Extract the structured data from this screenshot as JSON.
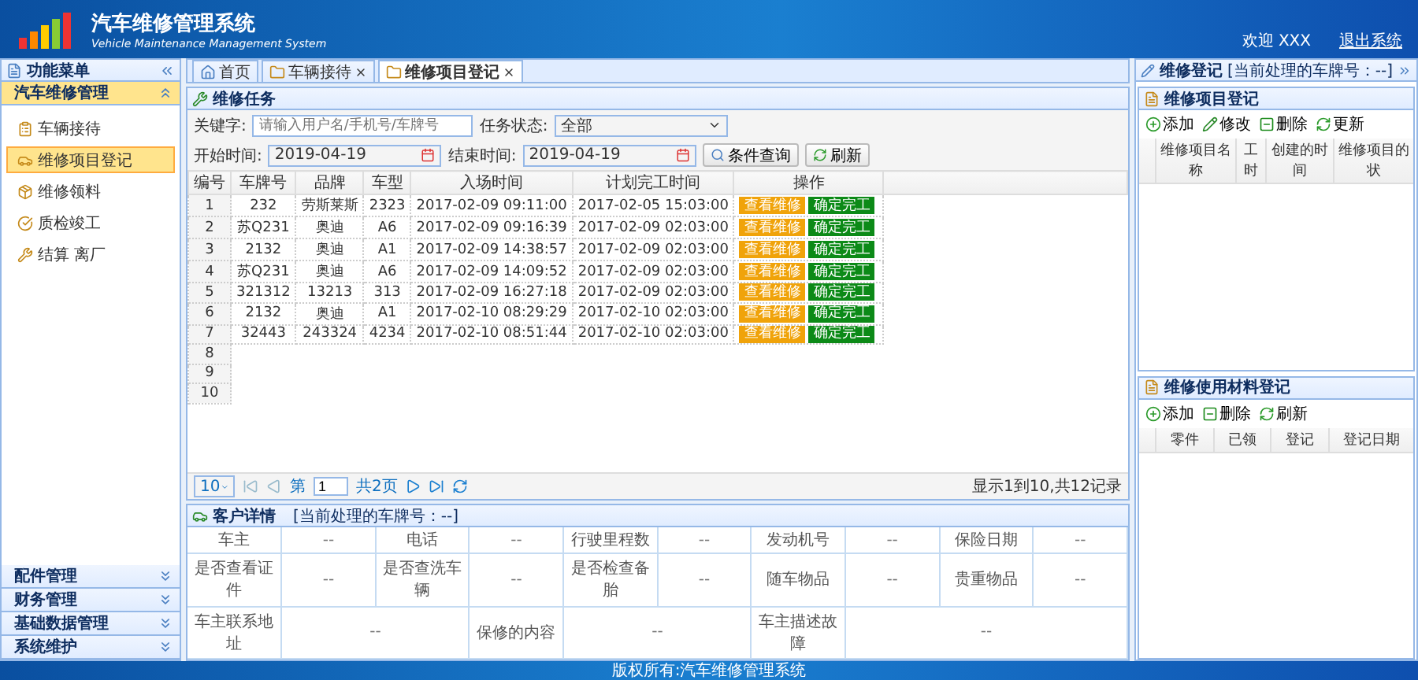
{
  "header": {
    "title": "汽车维修管理系统",
    "subtitle": "Vehicle Maintenance Management System",
    "welcome": "欢迎 XXX",
    "logout": "退出系统"
  },
  "sidebar": {
    "title": "功能菜单",
    "groups": [
      {
        "label": "汽车维修管理",
        "expanded": true,
        "items": [
          {
            "label": "车辆接待",
            "selected": false
          },
          {
            "label": "维修项目登记",
            "selected": true
          },
          {
            "label": "维修领料",
            "selected": false
          },
          {
            "label": "质检竣工",
            "selected": false
          },
          {
            "label": "结算 离厂",
            "selected": false
          }
        ]
      },
      {
        "label": "配件管理",
        "expanded": false
      },
      {
        "label": "财务管理",
        "expanded": false
      },
      {
        "label": "基础数据管理",
        "expanded": false
      },
      {
        "label": "系统维护",
        "expanded": false
      }
    ]
  },
  "tabs": [
    {
      "label": "首页",
      "closable": false,
      "selected": false
    },
    {
      "label": "车辆接待",
      "closable": true,
      "selected": false
    },
    {
      "label": "维修项目登记",
      "closable": true,
      "selected": true
    }
  ],
  "task_panel": {
    "title": "维修任务",
    "filters": {
      "keyword_label": "关键字:",
      "keyword_placeholder": "请输入用户名/手机号/车牌号",
      "status_label": "任务状态:",
      "status_value": "全部",
      "start_label": "开始时间:",
      "start_value": "2019-04-19",
      "end_label": "结束时间:",
      "end_value": "2019-04-19",
      "search_button": "条件查询",
      "refresh_button": "刷新"
    },
    "columns": [
      "编号",
      "车牌号",
      "品牌",
      "车型",
      "入场时间",
      "计划完工时间",
      "操作"
    ],
    "rows": [
      {
        "no": "1",
        "cells": [
          "232",
          "劳斯莱斯",
          "2323",
          "2017-02-09 09:11:00",
          "2017-02-05 15:03:00"
        ],
        "actions": [
          {
            "label": "查看维修",
            "kind": "view"
          },
          {
            "label": "确定完工",
            "kind": "finish"
          }
        ]
      },
      {
        "no": "2",
        "cells": [
          "苏Q231",
          "奥迪",
          "A6",
          "2017-02-09 09:16:39",
          "2017-02-09 02:03:00"
        ],
        "actions": [
          {
            "label": "查看维修",
            "kind": "view"
          },
          {
            "label": "确定完工",
            "kind": "finish"
          }
        ]
      },
      {
        "no": "3",
        "cells": [
          "2132",
          "奥迪",
          "A1",
          "2017-02-09 14:38:57",
          "2017-02-09 02:03:00"
        ],
        "actions": [
          {
            "label": "查看维修",
            "kind": "view"
          },
          {
            "label": "确定完工",
            "kind": "finish"
          }
        ]
      },
      {
        "no": "4",
        "cells": [
          "苏Q231",
          "奥迪",
          "A6",
          "2017-02-09 14:09:52",
          "2017-02-09 02:03:00"
        ],
        "actions": [
          {
            "label": "查看维修",
            "kind": "view"
          },
          {
            "label": "确定完工",
            "kind": "finish"
          }
        ]
      },
      {
        "no": "5",
        "cells": [
          "321312",
          "13213",
          "313",
          "2017-02-09 16:27:18",
          "2017-02-09 02:03:00"
        ],
        "actions": [
          {
            "label": "查看维修",
            "kind": "view"
          },
          {
            "label": "确定完工",
            "kind": "finish"
          }
        ]
      },
      {
        "no": "6",
        "cells": [
          "2132",
          "奥迪",
          "A1",
          "2017-02-10 08:29:29",
          "2017-02-10 02:03:00"
        ],
        "actions": [
          {
            "label": "查看维修",
            "kind": "view"
          },
          {
            "label": "确定完工",
            "kind": "finish"
          }
        ]
      },
      {
        "no": "7",
        "cells": [
          "32443",
          "243324",
          "4234",
          "2017-02-10 08:51:44",
          "2017-02-10 02:03:00"
        ],
        "actions": [
          {
            "label": "查看维修",
            "kind": "view"
          },
          {
            "label": "确定完工",
            "kind": "finish"
          }
        ]
      },
      {
        "no": "8"
      },
      {
        "no": "9"
      },
      {
        "no": "10"
      }
    ],
    "pager": {
      "page_size": "10",
      "page_label": "第",
      "page_value": "1",
      "page_total": "共2页",
      "summary": "显示1到10,共12记录"
    }
  },
  "detail": {
    "title": "客户详情",
    "note": "[当前处理的车牌号：--]",
    "rows": [
      [
        {
          "text": "车主",
          "kind": "label"
        },
        {
          "text": "--",
          "kind": "value"
        },
        {
          "text": "电话",
          "kind": "label"
        },
        {
          "text": "--",
          "kind": "value"
        },
        {
          "text": "行驶里程数",
          "kind": "label"
        },
        {
          "text": "--",
          "kind": "value"
        },
        {
          "text": "发动机号",
          "kind": "label"
        },
        {
          "text": "--",
          "kind": "value"
        },
        {
          "text": "保险日期",
          "kind": "label"
        },
        {
          "text": "--",
          "kind": "value"
        }
      ],
      [
        {
          "text": "是否查看证件",
          "kind": "label"
        },
        {
          "text": "--",
          "kind": "value"
        },
        {
          "text": "是否查洗车辆",
          "kind": "label"
        },
        {
          "text": "--",
          "kind": "value"
        },
        {
          "text": "是否检查备胎",
          "kind": "label"
        },
        {
          "text": "--",
          "kind": "value"
        },
        {
          "text": "随车物品",
          "kind": "label"
        },
        {
          "text": "--",
          "kind": "value"
        },
        {
          "text": "贵重物品",
          "kind": "label"
        },
        {
          "text": "--",
          "kind": "value"
        }
      ],
      [
        {
          "text": "车主联系地址",
          "kind": "label"
        },
        {
          "text": "--",
          "kind": "value",
          "colspan": 2
        },
        {
          "text": "保修的内容",
          "kind": "label"
        },
        {
          "text": "--",
          "kind": "value",
          "colspan": 2
        },
        {
          "text": "车主描述故障",
          "kind": "label"
        },
        {
          "text": "--",
          "kind": "value",
          "colspan": 3
        }
      ]
    ]
  },
  "right_panel": {
    "title": "维修登记",
    "note": "[当前处理的车牌号：--]",
    "sections": [
      {
        "title": "维修项目登记",
        "tools": [
          {
            "label": "添加",
            "kind": "add"
          },
          {
            "label": "修改",
            "kind": "edit"
          },
          {
            "label": "删除",
            "kind": "delete"
          },
          {
            "label": "更新",
            "kind": "refresh"
          }
        ],
        "columns": [
          "维修项目名称",
          "工时",
          "创建的时间",
          "维修项目的状"
        ]
      },
      {
        "title": "维修使用材料登记",
        "tools": [
          {
            "label": "添加",
            "kind": "add"
          },
          {
            "label": "删除",
            "kind": "delete"
          },
          {
            "label": "刷新",
            "kind": "refresh"
          }
        ],
        "columns": [
          "零件",
          "已领",
          "登记",
          "登记日期"
        ]
      }
    ]
  },
  "footer": "版权所有:汽车维修管理系统"
}
